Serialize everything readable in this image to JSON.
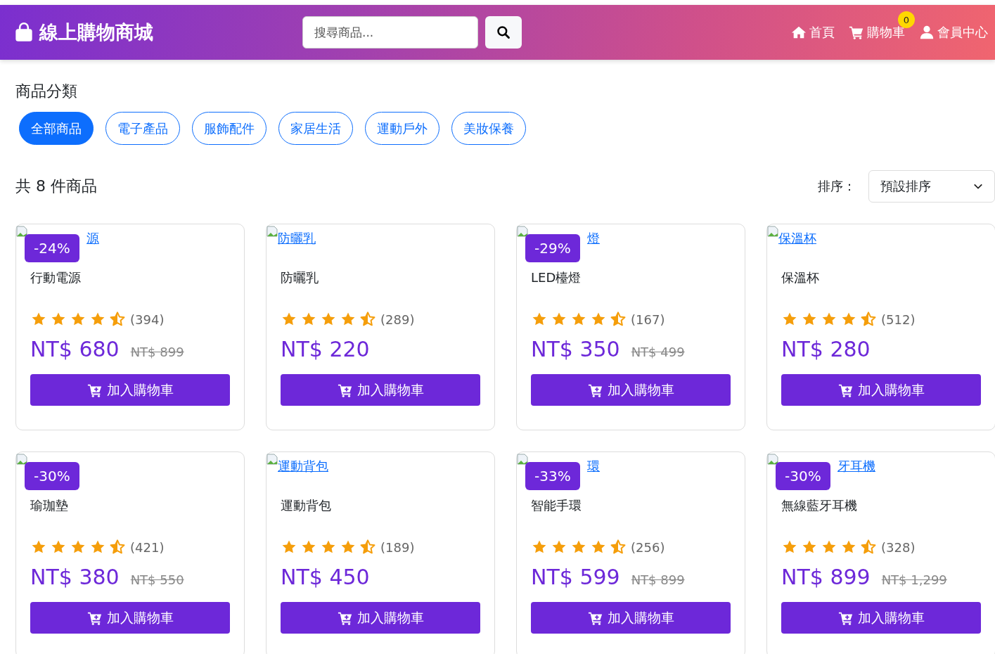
{
  "header": {
    "logo": "線上購物商城",
    "search": {
      "placeholder": "搜尋商品..."
    },
    "nav": [
      {
        "kind": "home",
        "label": "首頁"
      },
      {
        "kind": "cart",
        "label": "購物車",
        "badge": "0"
      },
      {
        "kind": "user",
        "label": "會員中心"
      }
    ]
  },
  "categories": {
    "title": "商品分類",
    "items": [
      {
        "label": "全部商品",
        "selected": true
      },
      {
        "label": "電子產品",
        "selected": false
      },
      {
        "label": "服飾配件",
        "selected": false
      },
      {
        "label": "家居生活",
        "selected": false
      },
      {
        "label": "運動戶外",
        "selected": false
      },
      {
        "label": "美妝保養",
        "selected": false
      }
    ]
  },
  "summary": "共 8 件商品",
  "sort": {
    "label": "排序：",
    "value": "預設排序"
  },
  "products": [
    {
      "image_alt": "源",
      "discount": "-24%",
      "name": "行動電源",
      "stars": 4.5,
      "reviews": "(394)",
      "price": "NT$ 680",
      "old_price": "NT$ 899",
      "button": "加入購物車"
    },
    {
      "image_alt": "防曬乳",
      "name": "防曬乳",
      "stars": 4.5,
      "reviews": "(289)",
      "price": "NT$ 220",
      "button": "加入購物車"
    },
    {
      "image_alt": "燈",
      "discount": "-29%",
      "name": "LED檯燈",
      "stars": 4.5,
      "reviews": "(167)",
      "price": "NT$ 350",
      "old_price": "NT$ 499",
      "button": "加入購物車"
    },
    {
      "image_alt": "保溫杯",
      "name": "保溫杯",
      "stars": 4.5,
      "reviews": "(512)",
      "price": "NT$ 280",
      "button": "加入購物車"
    },
    {
      "discount": "-30%",
      "name": "瑜珈墊",
      "stars": 4.5,
      "reviews": "(421)",
      "price": "NT$ 380",
      "old_price": "NT$ 550",
      "button": "加入購物車"
    },
    {
      "image_alt": "運動背包",
      "name": "運動背包",
      "stars": 4.5,
      "reviews": "(189)",
      "price": "NT$ 450",
      "button": "加入購物車"
    },
    {
      "image_alt": "環",
      "discount": "-33%",
      "name": "智能手環",
      "stars": 4.5,
      "reviews": "(256)",
      "price": "NT$ 599",
      "old_price": "NT$ 899",
      "button": "加入購物車"
    },
    {
      "image_alt": "牙耳機",
      "discount": "-30%",
      "name": "無線藍牙耳機",
      "stars": 4.5,
      "reviews": "(328)",
      "price": "NT$ 899",
      "old_price": "NT$ 1,299",
      "button": "加入購物車"
    }
  ]
}
